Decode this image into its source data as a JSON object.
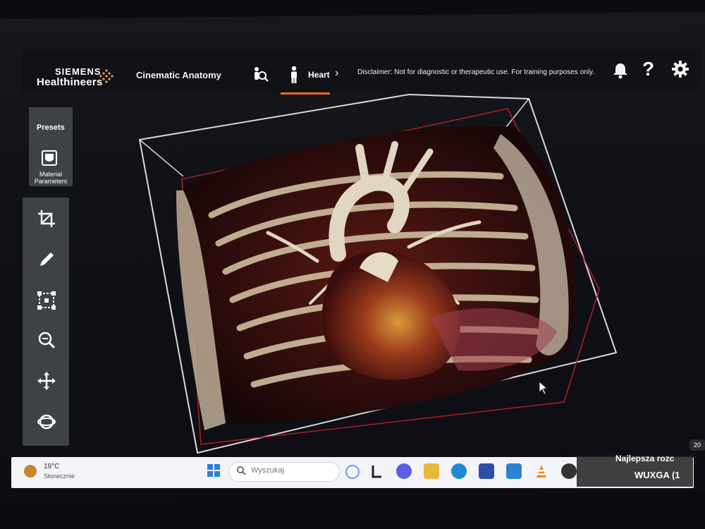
{
  "header": {
    "brand_line1": "SIEMENS",
    "brand_line2": "Healthineers",
    "app_title": "Cinematic Anatomy",
    "active_tab_label": "Heart",
    "disclaimer": "Disclaimer: Not for diagnostic or therapeutic use. For training purposes only.",
    "help_glyph": "?"
  },
  "left_panel": {
    "presets_label": "Presets",
    "material_label": "Material Parameters",
    "tools": [
      "crop-icon",
      "pencil-icon",
      "bounding-box-icon",
      "zoom-icon",
      "move-icon",
      "rotate-icon"
    ]
  },
  "taskbar": {
    "weather_temp": "19°C",
    "weather_desc": "Słonecznie",
    "search_placeholder": "Wyszukaj"
  },
  "overlay": {
    "line1": "Najlepsza rozc",
    "line2": "WUXGA (1",
    "corner_badge": "20"
  },
  "colors": {
    "accent_underline": "#e86a1e",
    "toolbar_bg": "#3e4146",
    "taskbar_bg": "#f3f4f8",
    "bounding_box_line": "#d9d9d9",
    "clip_box_line": "#b8202a"
  }
}
